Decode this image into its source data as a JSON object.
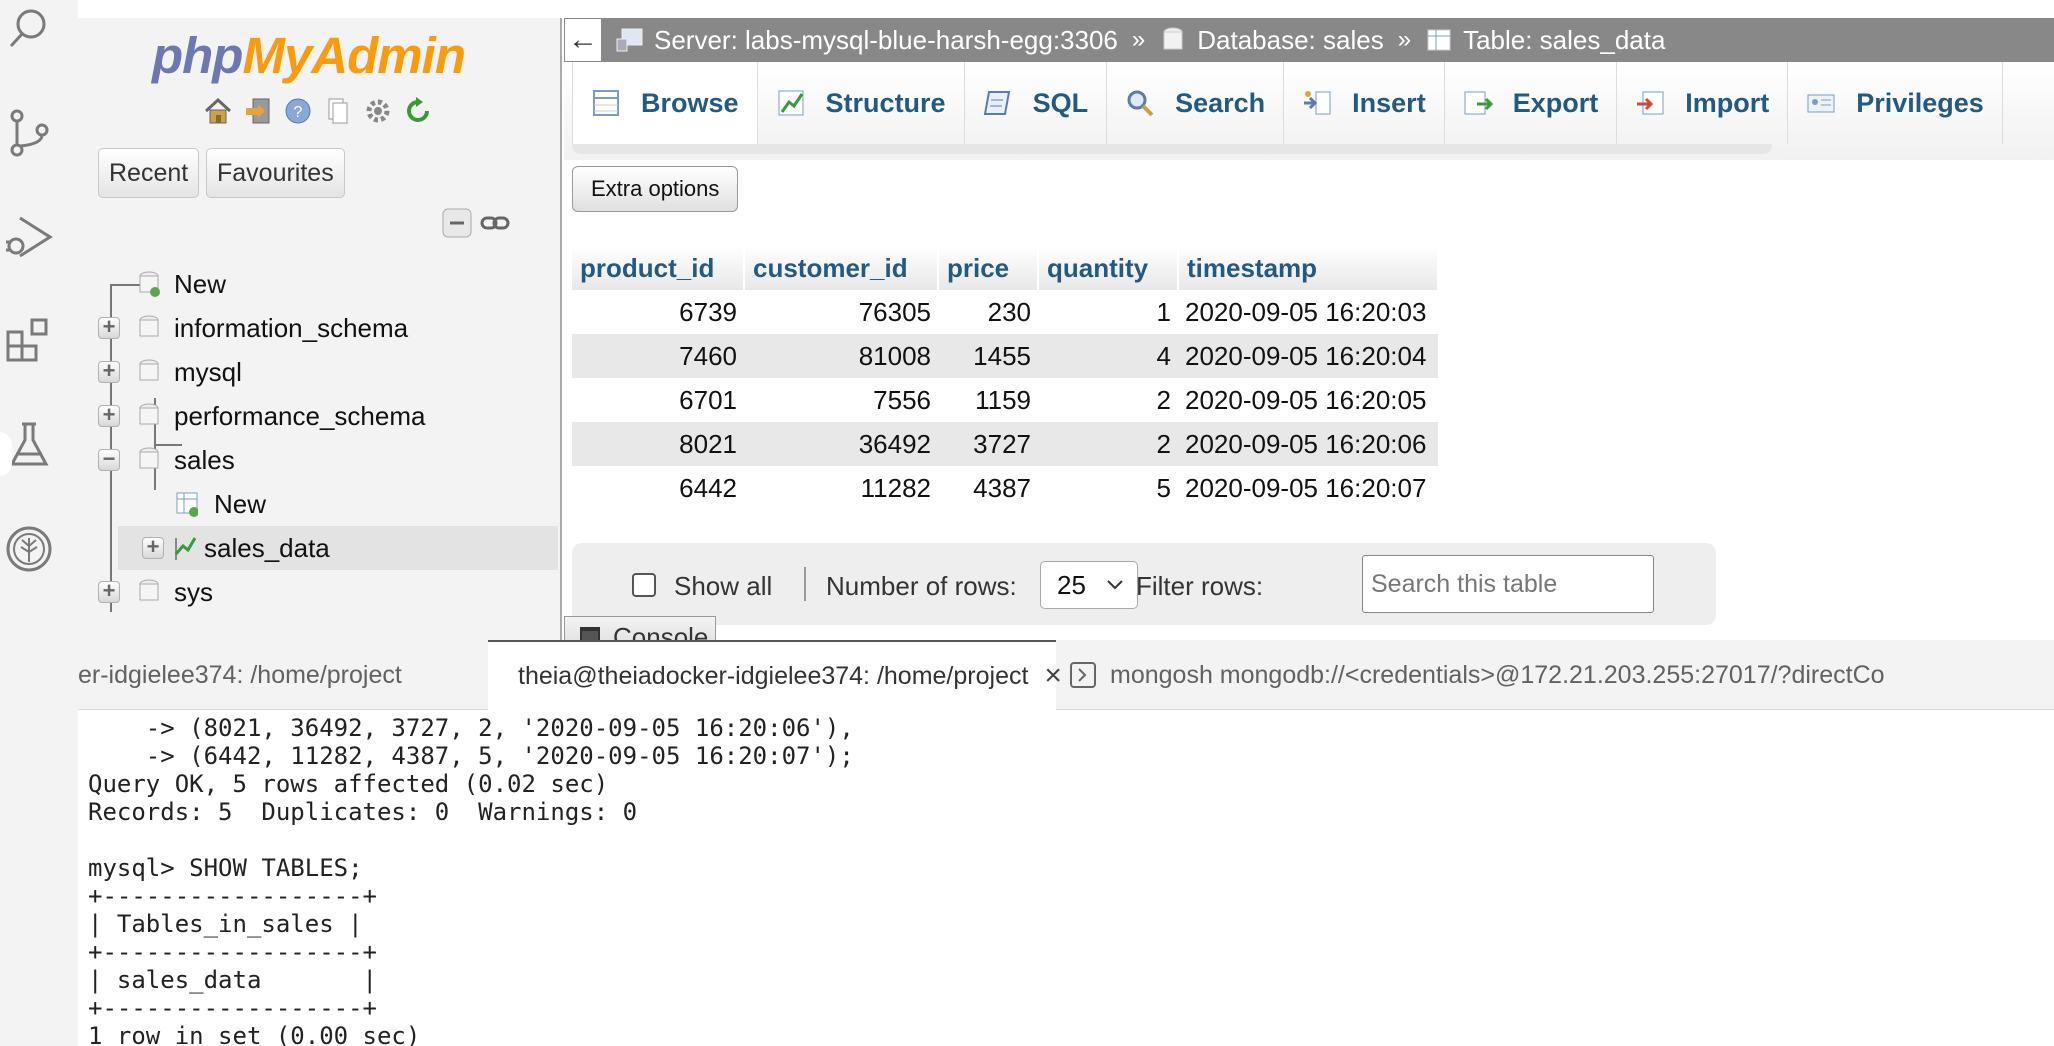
{
  "ide": {
    "activity_bar": [
      "search-icon",
      "source-control-icon",
      "run-debug-icon",
      "extensions-icon",
      "testing-icon",
      "tree-logo-icon"
    ]
  },
  "pma": {
    "logo": {
      "php": "php",
      "myadmin": "MyAdmin"
    },
    "quick_icons": [
      "home-icon",
      "logout-icon",
      "help-icon",
      "docs-icon",
      "settings-icon",
      "reload-icon"
    ],
    "nav_tabs": {
      "recent": "Recent",
      "favourites": "Favourites"
    },
    "tree": {
      "new": "New",
      "databases": [
        "information_schema",
        "mysql",
        "performance_schema",
        "sales",
        "sys"
      ],
      "sales_children": {
        "new": "New",
        "table": "sales_data"
      }
    },
    "breadcrumb": {
      "server": "Server: labs-mysql-blue-harsh-egg:3306",
      "database": "Database: sales",
      "table": "Table: sales_data",
      "separator": "»"
    },
    "tabs": [
      "Browse",
      "Structure",
      "SQL",
      "Search",
      "Insert",
      "Export",
      "Import",
      "Privileges"
    ],
    "extra_options": "Extra options",
    "table": {
      "columns": [
        "product_id",
        "customer_id",
        "price",
        "quantity",
        "timestamp"
      ],
      "rows": [
        [
          "6739",
          "76305",
          "230",
          "1",
          "2020-09-05 16:20:03"
        ],
        [
          "7460",
          "81008",
          "1455",
          "4",
          "2020-09-05 16:20:04"
        ],
        [
          "6701",
          "7556",
          "1159",
          "2",
          "2020-09-05 16:20:05"
        ],
        [
          "8021",
          "36492",
          "3727",
          "2",
          "2020-09-05 16:20:06"
        ],
        [
          "6442",
          "11282",
          "4387",
          "5",
          "2020-09-05 16:20:07"
        ]
      ]
    },
    "footer": {
      "show_all": "Show all",
      "number_of_rows_label": "Number of rows:",
      "number_of_rows_value": "25",
      "filter_label": "Filter rows:",
      "filter_placeholder": "Search this table"
    },
    "console": "Console"
  },
  "terminal": {
    "tabs": [
      "er-idgielee374: /home/project",
      "theia@theiadocker-idgielee374: /home/project",
      "mongosh mongodb://<credentials>@172.21.203.255:27017/?directCo"
    ],
    "lines": [
      "    -> (8021, 36492, 3727, 2, '2020-09-05 16:20:06'),",
      "    -> (6442, 11282, 4387, 5, '2020-09-05 16:20:07');",
      "Query OK, 5 rows affected (0.02 sec)",
      "Records: 5  Duplicates: 0  Warnings: 0",
      "",
      "mysql> SHOW TABLES;",
      "+------------------+",
      "| Tables_in_sales |",
      "+------------------+",
      "| sales_data       |",
      "+------------------+",
      "1 row in set (0.00 sec)"
    ]
  },
  "colors": {
    "link": "#235a81",
    "logo_php": "#6c78af",
    "logo_myadmin": "#f89c0e",
    "breadcrumb_bg": "#888888"
  }
}
